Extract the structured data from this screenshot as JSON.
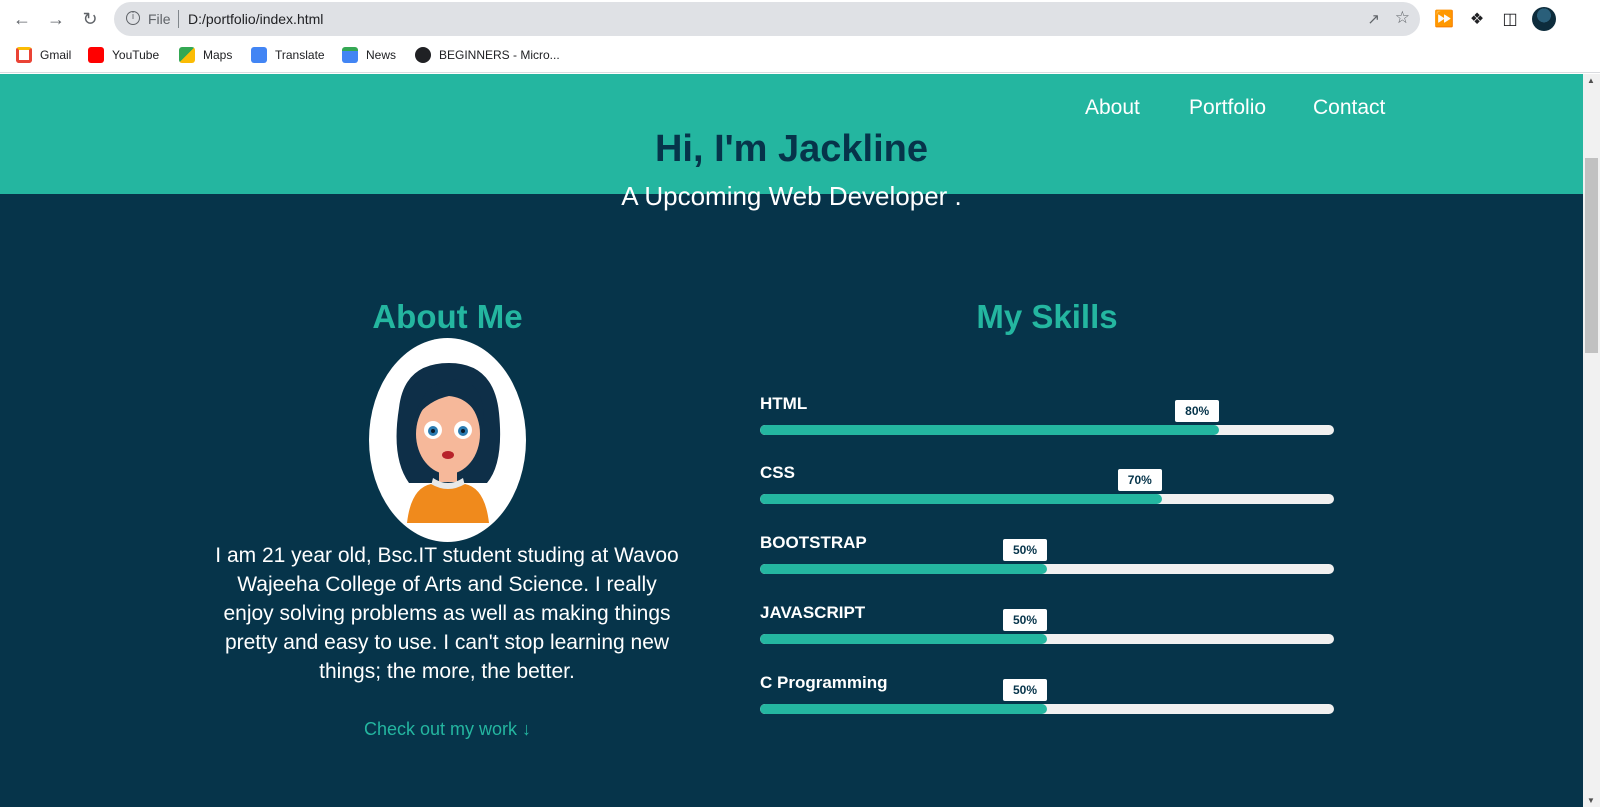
{
  "browser": {
    "url_scheme_label": "File",
    "url": "D:/portfolio/index.html",
    "bookmarks": [
      {
        "label": "Gmail",
        "color": "#ea4335"
      },
      {
        "label": "YouTube",
        "color": "#ff0000"
      },
      {
        "label": "Maps",
        "color": "#34a853"
      },
      {
        "label": "Translate",
        "color": "#4285f4"
      },
      {
        "label": "News",
        "color": "#4285f4"
      },
      {
        "label": "BEGINNERS - Micro...",
        "color": "#202124"
      }
    ]
  },
  "nav": {
    "links": [
      "About",
      "Portfolio",
      "Contact"
    ]
  },
  "hero": {
    "title": "Hi, I'm Jackline",
    "subtitle": "A Upcoming Web Developer ."
  },
  "about": {
    "heading": "About Me",
    "lines": [
      "I am 21 year old, Bsc.IT student studing at Wavoo",
      "Wajeeha College of Arts and Science. I really",
      "enjoy solving problems as well as making things",
      "pretty and easy to use. I can't stop learning new",
      "things; the more, the better."
    ],
    "cta": "Check out my work",
    "cta_icon": "arrow-down-icon"
  },
  "skills": {
    "heading": "My Skills",
    "items": [
      {
        "name": "HTML",
        "percent_label": "80%",
        "level": 0.8
      },
      {
        "name": "CSS",
        "percent_label": "70%",
        "level": 0.7
      },
      {
        "name": "BOOTSTRAP",
        "percent_label": "50%",
        "level": 0.5
      },
      {
        "name": "JAVASCRIPT",
        "percent_label": "50%",
        "level": 0.5
      },
      {
        "name": "C Programming",
        "percent_label": "50%",
        "level": 0.5
      }
    ]
  },
  "colors": {
    "accent": "#24b6a0",
    "background": "#06344a",
    "text": "#ffffff"
  }
}
